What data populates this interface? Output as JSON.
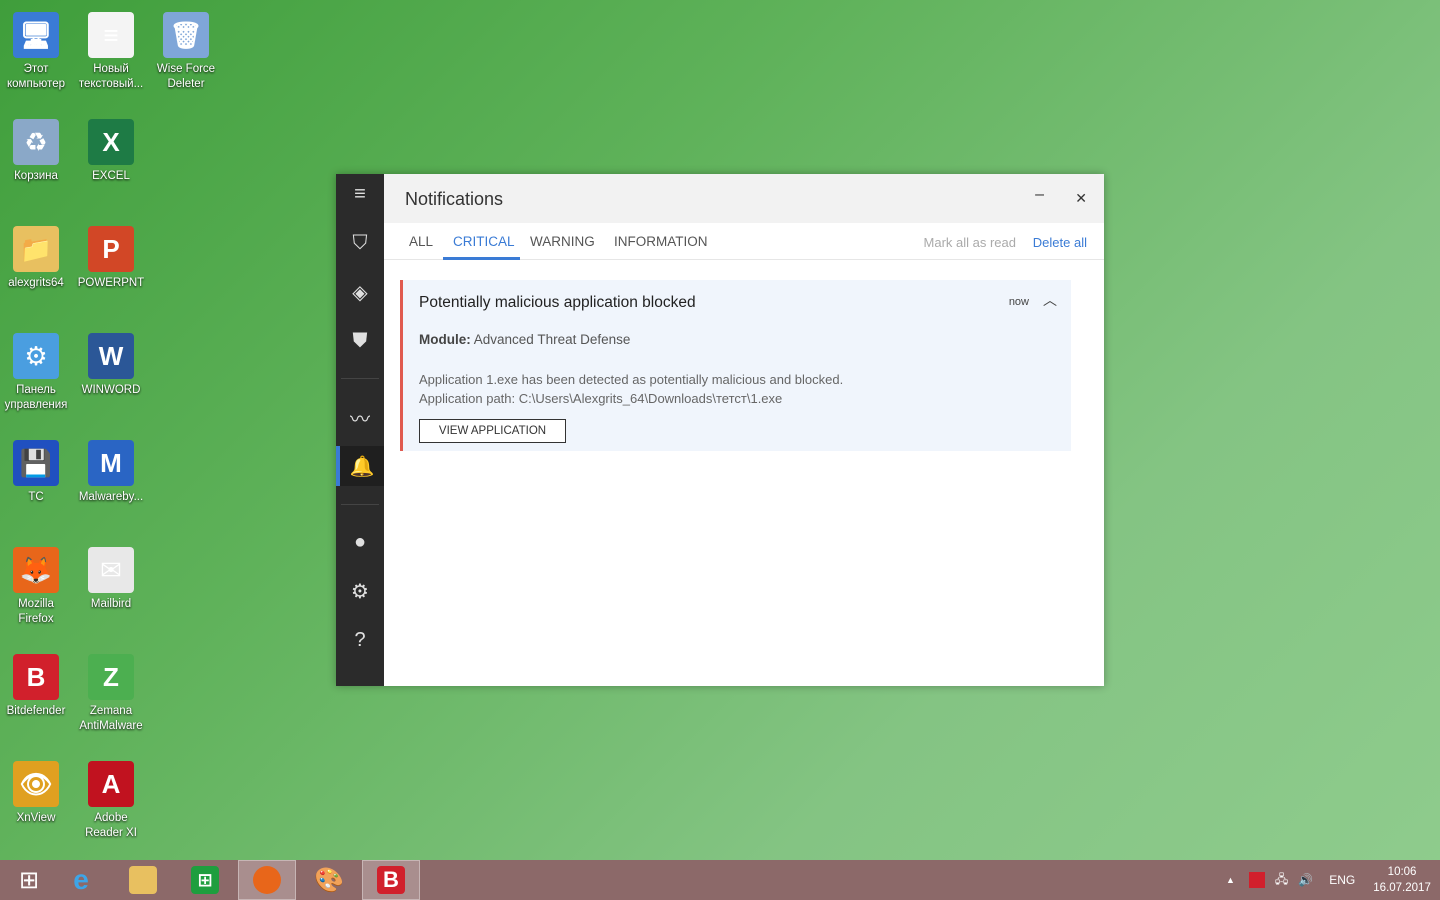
{
  "desktop": {
    "icons": [
      {
        "label": "Этот компьютер",
        "glyph": "🖥",
        "color": "#3a7bd5"
      },
      {
        "label": "Корзина",
        "glyph": "♻",
        "color": "#8aa8c8"
      },
      {
        "label": "alexgrits64",
        "glyph": "📁",
        "color": "#e8c060"
      },
      {
        "label": "Панель управления",
        "glyph": "⚙",
        "color": "#4a9ee0"
      },
      {
        "label": "TC",
        "glyph": "💾",
        "color": "#2050c0"
      },
      {
        "label": "Mozilla Firefox",
        "glyph": "🦊",
        "color": "#e8661a"
      },
      {
        "label": "Bitdefender",
        "glyph": "B",
        "color": "#d1202c"
      },
      {
        "label": "XnView",
        "glyph": "👁",
        "color": "#e0a020"
      },
      {
        "label": "Новый текстовый...",
        "glyph": "≡",
        "color": "#f4f4f4"
      },
      {
        "label": "EXCEL",
        "glyph": "X",
        "color": "#1e7b45"
      },
      {
        "label": "POWERPNT",
        "glyph": "P",
        "color": "#d24726"
      },
      {
        "label": "WINWORD",
        "glyph": "W",
        "color": "#2b5797"
      },
      {
        "label": "Malwareby...",
        "glyph": "M",
        "color": "#2a65c4"
      },
      {
        "label": "Mailbird",
        "glyph": "✉",
        "color": "#e8e8e8"
      },
      {
        "label": "Zemana AntiMalware",
        "glyph": "Z",
        "color": "#4caf50"
      },
      {
        "label": "Adobe Reader XI",
        "glyph": "A",
        "color": "#c1121f"
      },
      {
        "label": "Wise Force Deleter",
        "glyph": "🗑",
        "color": "#7fa6d8"
      }
    ]
  },
  "window": {
    "title": "Notifications",
    "minimize": "–",
    "close": "✕",
    "tabs": [
      "ALL",
      "CRITICAL",
      "WARNING",
      "INFORMATION"
    ],
    "active_tab": "CRITICAL",
    "mark_all_read": "Mark all as read",
    "delete_all": "Delete all",
    "accent": "#3a7bd5",
    "notification": {
      "title": "Potentially malicious application blocked",
      "time": "now",
      "module_label": "Module:",
      "module": "Advanced Threat Defense",
      "line1": "Application 1.exe has been detected as potentially malicious and blocked.",
      "line2": "Application path: C:\\Users\\Alexgrits_64\\Downloads\\тетст\\1.exe",
      "button": "VIEW APPLICATION"
    }
  },
  "taskbar": {
    "language": "ENG",
    "time": "10:06",
    "date": "16.07.2017",
    "tray_arrow": "▲"
  }
}
